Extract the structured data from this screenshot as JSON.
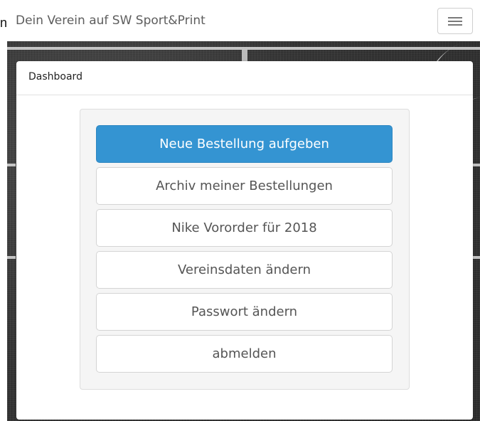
{
  "navbar": {
    "brand_prefix": "n",
    "brand": "Dein Verein auf SW Sport&Print",
    "menu_icon": "hamburger-menu-icon"
  },
  "dashboard": {
    "title": "Dashboard",
    "buttons": [
      {
        "label": "Neue Bestellung aufgeben",
        "style": "primary"
      },
      {
        "label": "Archiv meiner Bestellungen",
        "style": "secondary"
      },
      {
        "label": "Nike Vororder für 2018",
        "style": "secondary"
      },
      {
        "label": "Vereinsdaten ändern",
        "style": "secondary"
      },
      {
        "label": "Passwort ändern",
        "style": "secondary"
      },
      {
        "label": "abmelden",
        "style": "secondary"
      }
    ]
  },
  "colors": {
    "primary": "#3494d2",
    "panel_background": "#f5f5f5",
    "page_background": "#2f2f2f"
  }
}
